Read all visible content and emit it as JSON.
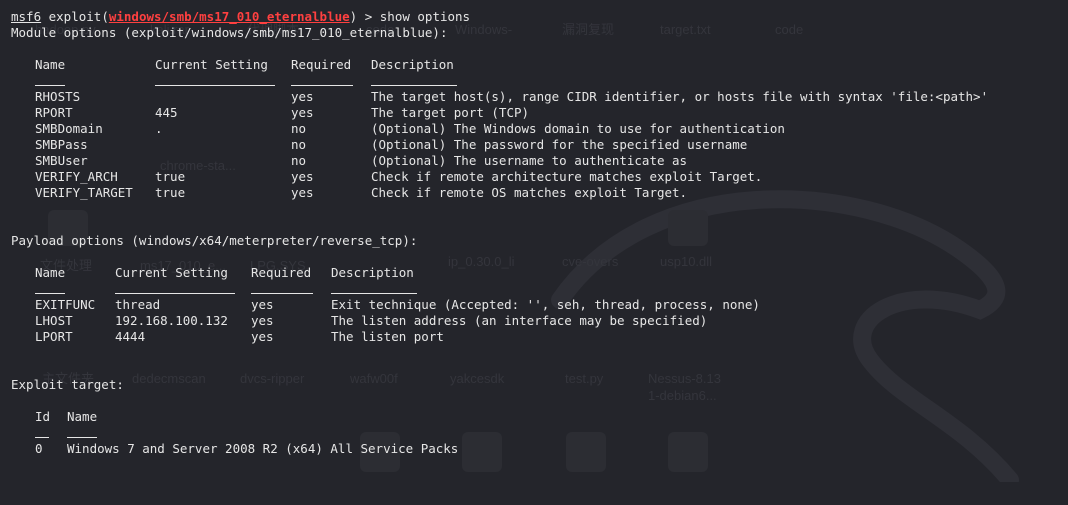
{
  "bg_color": "#24252b",
  "text_color": "#e6e6e6",
  "accent_red": "#ff4040",
  "prompt": {
    "name": "msf6",
    "cmd_prefix": " exploit(",
    "module": "windows/smb/ms17_010_eternalblue",
    "cmd_suffix": ") > show options"
  },
  "module_options": {
    "title": "Module options (exploit/windows/smb/ms17_010_eternalblue):",
    "headers": [
      "Name",
      "Current Setting",
      "Required",
      "Description"
    ],
    "rows": [
      [
        "RHOSTS",
        "",
        "yes",
        "The target host(s), range CIDR identifier, or hosts file with syntax 'file:<path>'"
      ],
      [
        "RPORT",
        "445",
        "yes",
        "The target port (TCP)"
      ],
      [
        "SMBDomain",
        ".",
        "no",
        "(Optional) The Windows domain to use for authentication"
      ],
      [
        "SMBPass",
        "",
        "no",
        "(Optional) The password for the specified username"
      ],
      [
        "SMBUser",
        "",
        "no",
        "(Optional) The username to authenticate as"
      ],
      [
        "VERIFY_ARCH",
        "true",
        "yes",
        "Check if remote architecture matches exploit Target."
      ],
      [
        "VERIFY_TARGET",
        "true",
        "yes",
        "Check if remote OS matches exploit Target."
      ]
    ]
  },
  "payload_options": {
    "title": "Payload options (windows/x64/meterpreter/reverse_tcp):",
    "headers": [
      "Name",
      "Current Setting",
      "Required",
      "Description"
    ],
    "rows": [
      [
        "EXITFUNC",
        "thread",
        "yes",
        "Exit technique (Accepted: '', seh, thread, process, none)"
      ],
      [
        "LHOST",
        "192.168.100.132",
        "yes",
        "The listen address (an interface may be specified)"
      ],
      [
        "LPORT",
        "4444",
        "yes",
        "The listen port"
      ]
    ]
  },
  "exploit_target": {
    "title": "Exploit target:",
    "headers": [
      "Id",
      "Name"
    ],
    "rows": [
      [
        "0",
        "Windows 7 and Server 2008 R2 (x64) All Service Packs"
      ]
    ]
  },
  "background_labels": [
    "hadoop.py",
    "kali.rar",
    "代理脚本",
    "code",
    "Windows-",
    "漏洞复现",
    "target.txt",
    "code",
    "chrome-sta...",
    "文件处理",
    "ms17_010_e...",
    "LPG.SYS.",
    "ip_0.30.0_li",
    "cve-overs",
    "usp10.dll",
    "主文件夹",
    "dedecmscan",
    "dvcs-ripper",
    "wafw00f",
    "yakcesdk",
    "test.py",
    "Nessus-8.13",
    "1-debian6..."
  ]
}
